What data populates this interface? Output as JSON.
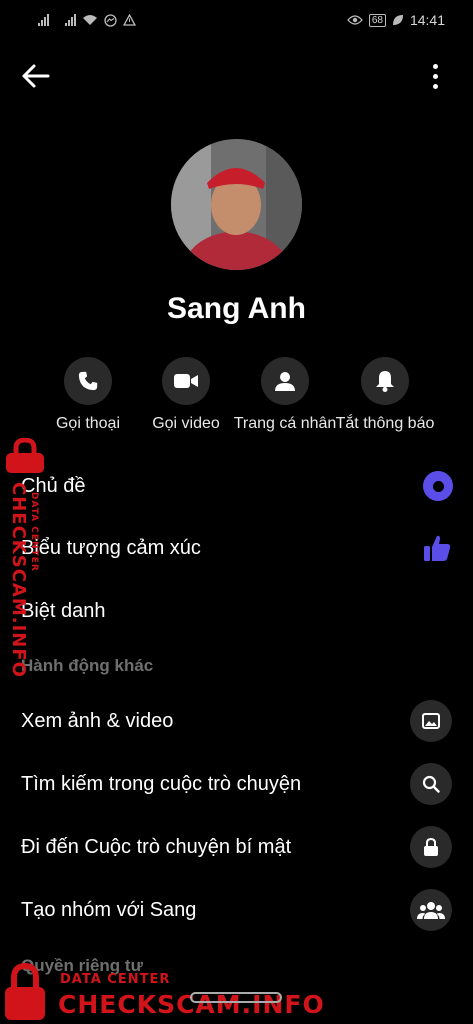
{
  "status_bar": {
    "time": "14:41",
    "battery": "68"
  },
  "profile": {
    "name": "Sang Anh"
  },
  "actions": [
    {
      "label": "Gọi thoại",
      "icon": "phone-icon"
    },
    {
      "label": "Gọi video",
      "icon": "video-camera-icon"
    },
    {
      "label": "Trang cá nhân",
      "icon": "person-icon"
    },
    {
      "label": "Tắt thông báo",
      "icon": "bell-icon"
    }
  ],
  "customization": [
    {
      "label": "Chủ đề",
      "icon": "theme-icon"
    },
    {
      "label": "Biểu tượng cảm xúc",
      "icon": "thumbs-up-icon"
    },
    {
      "label": "Biệt danh"
    }
  ],
  "more_actions": {
    "header": "Hành động khác",
    "items": [
      {
        "label": "Xem ảnh & video",
        "icon": "image-icon"
      },
      {
        "label": "Tìm kiếm trong cuộc trò chuyện",
        "icon": "search-icon"
      },
      {
        "label": "Đi đến Cuộc trò chuyện bí mật",
        "icon": "lock-icon"
      },
      {
        "label": "Tạo nhóm với Sang",
        "icon": "group-icon"
      }
    ]
  },
  "privacy": {
    "header": "Quyền riêng tư"
  },
  "watermark": {
    "site": "CHECKSCAM.INFO",
    "tag": "DATA CENTER"
  },
  "colors": {
    "accent": "#5b4ee8",
    "watermark": "#d1141a"
  }
}
